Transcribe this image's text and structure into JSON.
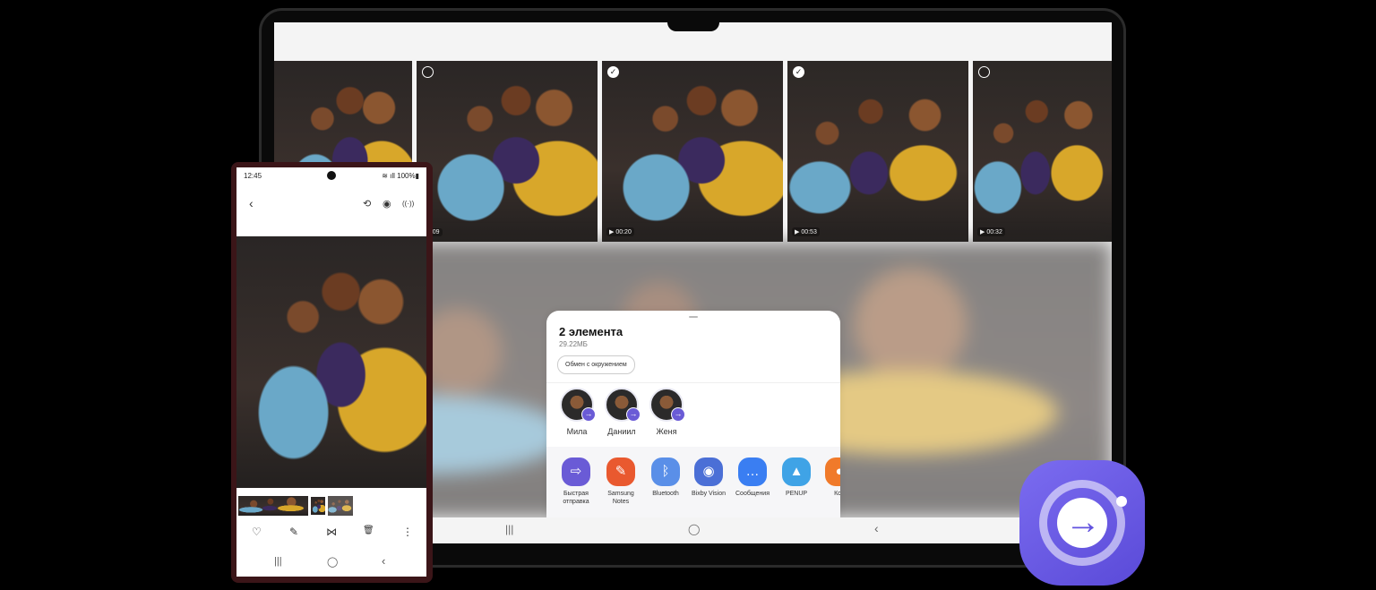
{
  "tablet": {
    "videos": [
      {
        "selected": null,
        "duration": ""
      },
      {
        "selected": false,
        "duration": "00:09"
      },
      {
        "selected": true,
        "duration": "00:20"
      },
      {
        "selected": true,
        "duration": "00:53"
      },
      {
        "selected": false,
        "duration": "00:32"
      }
    ],
    "share_sheet": {
      "title": "2 элемента",
      "size": "29.22МБ",
      "nearby_button": "Обмен с окружением",
      "contacts": [
        {
          "name": "Мила"
        },
        {
          "name": "Даниил"
        },
        {
          "name": "Женя"
        }
      ],
      "apps": [
        {
          "label": "Быстрая отправка",
          "icon": "quick-share-icon",
          "color": "#6a5bd6"
        },
        {
          "label": "Samsung Notes",
          "icon": "notes-icon",
          "color": "#e9592f"
        },
        {
          "label": "Bluetooth",
          "icon": "bluetooth-icon",
          "color": "#5a8fe8"
        },
        {
          "label": "Bixby Vision",
          "icon": "eye-icon",
          "color": "#4b6fd6"
        },
        {
          "label": "Сообщения",
          "icon": "message-icon",
          "color": "#3a7ef2"
        },
        {
          "label": "PENUP",
          "icon": "penup-icon",
          "color": "#3fa3e6"
        },
        {
          "label": "Кон",
          "icon": "contacts-icon",
          "color": "#f07a2a"
        }
      ]
    },
    "nav": {
      "recent": "|||",
      "home": "◯",
      "back": "‹"
    }
  },
  "phone": {
    "status_time": "12:45",
    "status_battery": "100%",
    "top_icons": {
      "back": "‹",
      "rotate": "⟲",
      "view": "◉",
      "share": "((·))"
    },
    "actions": {
      "favorite": "♡",
      "edit": "✎",
      "share": "⋈",
      "delete": "🗑",
      "more": "⋮"
    },
    "nav": {
      "recent": "|||",
      "home": "◯",
      "back": "‹"
    }
  },
  "brand": {
    "accent": "#6a5bd6",
    "quick_share_icon": "quick-share-icon"
  }
}
